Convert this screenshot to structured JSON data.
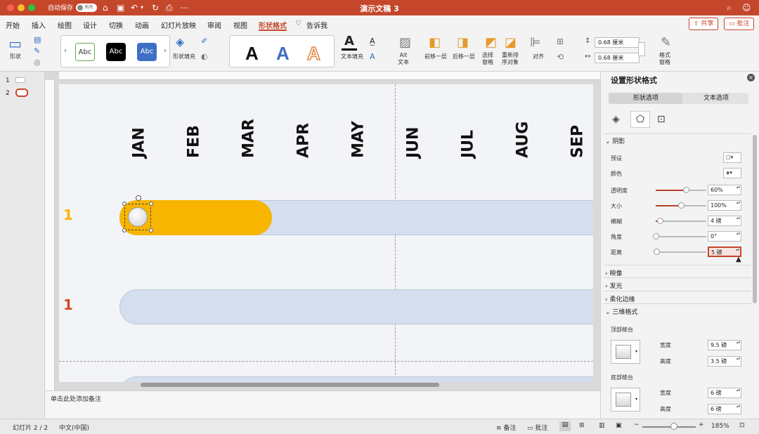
{
  "window": {
    "title": "演示文稿 3",
    "autosave_label": "自动保存",
    "autosave_state": "关闭"
  },
  "menu": {
    "items": [
      "开始",
      "插入",
      "绘图",
      "设计",
      "切换",
      "动画",
      "幻灯片放映",
      "审阅",
      "视图",
      "形状格式"
    ],
    "tellme": "告诉我",
    "share": "共享",
    "comments": "批注"
  },
  "ribbon": {
    "shape_label": "形状",
    "style_sample": "Abc",
    "shape_fill": "形状填充",
    "wordart": "A",
    "text_fill": "文本填充",
    "alt_text": "Alt\n文本",
    "bring_forward": "前移一层",
    "send_backward": "后移一层",
    "selection_pane": "选择\n窗格",
    "reorder": "重新排\n序对象",
    "align": "对齐",
    "height": "0.68 厘米",
    "width": "0.68 厘米",
    "format_pane": "格式\n窗格"
  },
  "thumbs": {
    "slide1": "1",
    "slide2": "2"
  },
  "slide": {
    "months": [
      "JAN",
      "FEB",
      "MAR",
      "APR",
      "MAY",
      "JUN",
      "JUL",
      "AUG",
      "SEP"
    ],
    "row_label_1": "1",
    "row_label_2": "1",
    "progress_fraction": 0.31
  },
  "notes_placeholder": "单击此处添加备注",
  "pane": {
    "title": "设置形状格式",
    "tab_shape": "形状选项",
    "tab_text": "文本选项",
    "shadow": "阴影",
    "preset": "预设",
    "color": "颜色",
    "transparency": {
      "label": "透明度",
      "value": "60%",
      "level": 0.6
    },
    "size": {
      "label": "大小",
      "value": "100%",
      "level": 0.5
    },
    "blur": {
      "label": "模糊",
      "value": "4 磅",
      "level": 0.08
    },
    "angle": {
      "label": "角度",
      "value": "0°",
      "level": 0.0
    },
    "distance": {
      "label": "距离",
      "value": "5 磅",
      "level": 0.02
    },
    "reflection": "映像",
    "glow": "发光",
    "soft_edges": "柔化边缘",
    "three_d": "三维格式",
    "top_bevel": "顶部棱台",
    "bottom_bevel": "底部棱台",
    "width_label": "宽度",
    "height_label": "高度",
    "top_width": "9.5 磅",
    "top_height": "3.5 磅",
    "bottom_width": "6 磅",
    "bottom_height": "6 磅"
  },
  "status": {
    "slide_pos": "幻灯片 2 / 2",
    "language": "中文(中国)",
    "notes": "备注",
    "comments": "批注",
    "zoom": "185%"
  },
  "colors": {
    "accent": "#c4462b",
    "progress": "#f8b500",
    "track": "#d4deee"
  }
}
